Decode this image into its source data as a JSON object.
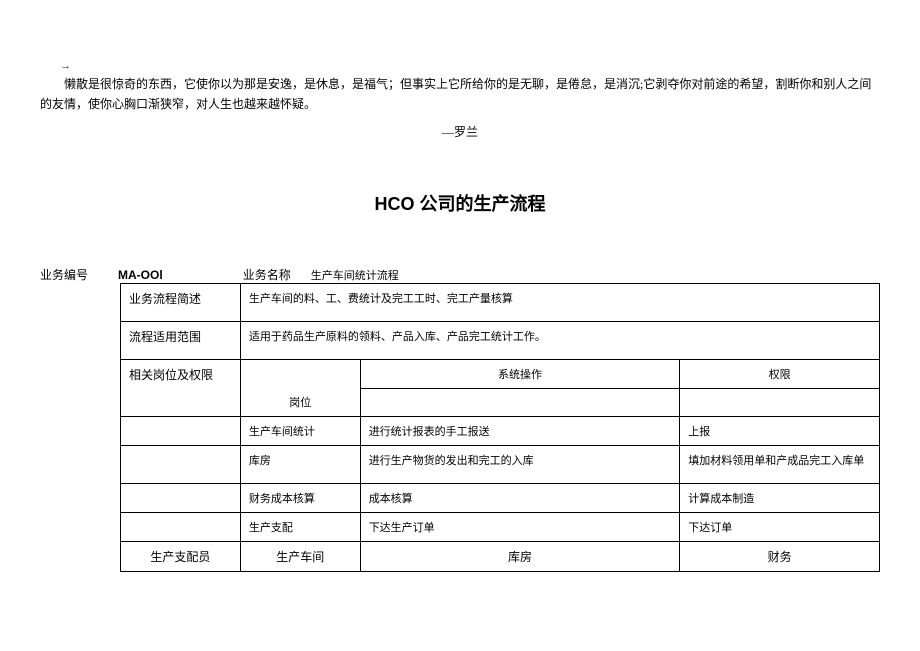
{
  "quote": {
    "arrow": "→",
    "text": "懒散是很惊奇的东西，它使你以为那是安逸，是休息，是福气；但事实上它所给你的是无聊，是倦怠，是消沉;它剥夺你对前途的希望，割断你和别人之间的友情，使你心胸口渐狭窄，对人生也越来越怀疑。",
    "author": "—罗兰"
  },
  "title": "HCO 公司的生产流程",
  "header": {
    "biz_no_label": "业务编号",
    "biz_no_value": "MA-OOl",
    "biz_name_label": "业务名称",
    "biz_name_value": "生产车间统计流程"
  },
  "table": {
    "row1_label": "业务流程简述",
    "row1_value": "生产车间的料、工、费统计及完工工时、完工产量核算",
    "row2_label": "流程适用范围",
    "row2_value": "适用于药品生产原料的领料、产品入库、产品完工统计工作。",
    "row3_label": "相关岗位及权限",
    "row3_pos_header": "岗位",
    "row3_op_header": "系统操作",
    "row3_perm_header": "权限",
    "roles": [
      {
        "pos": "生产车间统计",
        "op": "进行统计报表的手工报送",
        "perm": "上报"
      },
      {
        "pos": "库房",
        "op": "进行生产物货的发出和完工的入库",
        "perm": "填加材料领用单和产成品完工入库单"
      },
      {
        "pos": "财务成本核算",
        "op": "成本核算",
        "perm": "计算成本制造"
      },
      {
        "pos": "生产支配",
        "op": "下达生产订单",
        "perm": "下达订单"
      }
    ],
    "bottom": {
      "c1": "生产支配员",
      "c2": "生产车间",
      "c3": "库房",
      "c4": "财务"
    }
  }
}
